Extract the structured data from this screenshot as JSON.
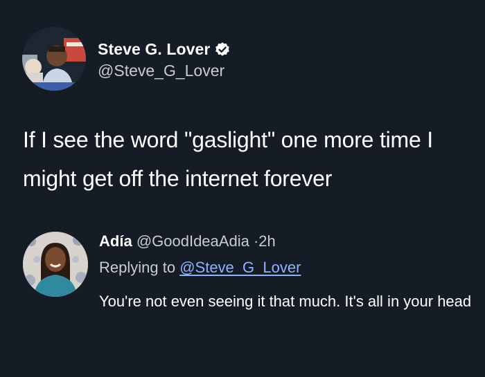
{
  "tweet": {
    "display_name": "Steve G. Lover",
    "handle": "@Steve_G_Lover",
    "verified": true,
    "verified_icon": "verified-badge-icon",
    "avatar_icon": "profile-photo",
    "text": "If I see the word \"gaslight\" one more time I might get off the internet forever"
  },
  "reply": {
    "display_name": "Adía",
    "handle": "@GoodIdeaAdia",
    "separator": "·",
    "time": "2h",
    "replying_label": "Replying to",
    "replying_to": "@Steve_G_Lover",
    "avatar_icon": "profile-photo",
    "text": "You're not even seeing it that much. It's all in your head"
  },
  "colors": {
    "background": "#151c26",
    "primary_text": "#ffffff",
    "secondary_text": "#c8ccd2",
    "link": "#8fb3ff"
  }
}
